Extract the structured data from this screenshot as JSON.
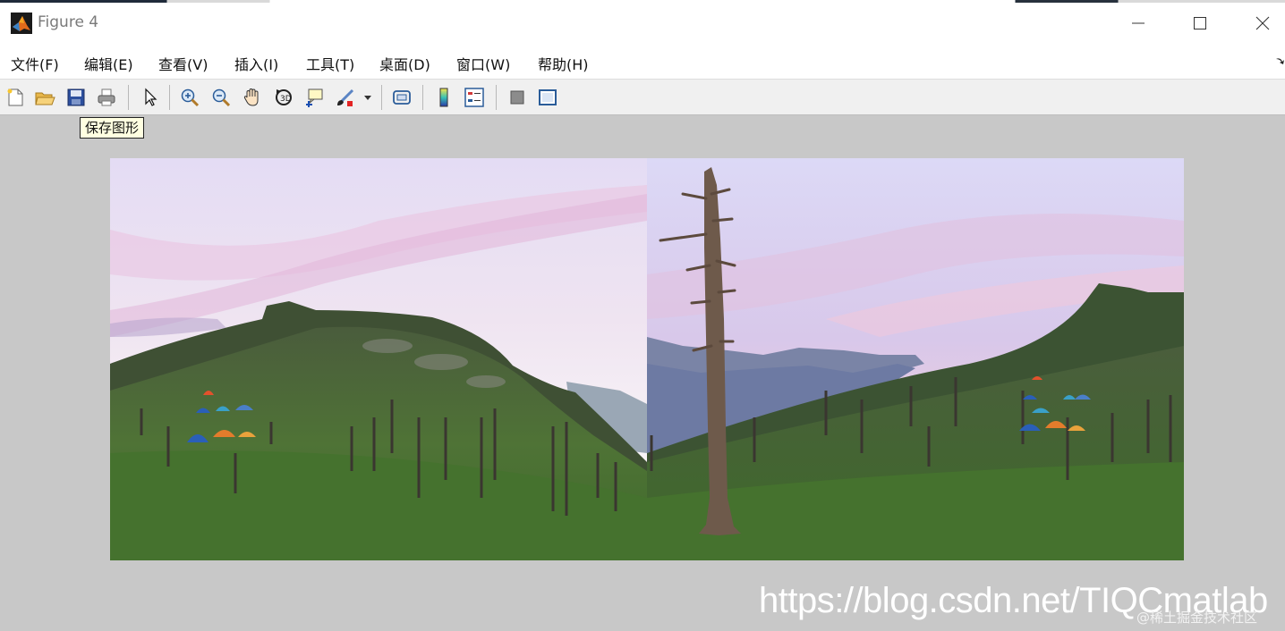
{
  "window": {
    "title": "Figure 4",
    "controls": [
      "minimize",
      "maximize",
      "close"
    ]
  },
  "menu": {
    "items": [
      {
        "label": "文件(F)"
      },
      {
        "label": "编辑(E)"
      },
      {
        "label": "查看(V)"
      },
      {
        "label": "插入(I)"
      },
      {
        "label": "工具(T)"
      },
      {
        "label": "桌面(D)"
      },
      {
        "label": "窗口(W)"
      },
      {
        "label": "帮助(H)"
      }
    ]
  },
  "toolbar": {
    "buttons": [
      "new-figure-icon",
      "open-file-icon",
      "save-figure-icon",
      "print-figure-icon",
      "edit-plot-cursor-icon",
      "zoom-in-icon",
      "zoom-out-icon",
      "pan-hand-icon",
      "rotate-3d-icon",
      "data-cursor-icon",
      "brush-icon",
      "brush-dropdown-icon",
      "link-plot-icon",
      "insert-colorbar-icon",
      "insert-legend-icon",
      "hide-plot-tools-icon",
      "show-plot-tools-icon"
    ],
    "tooltip": "保存图形"
  },
  "figure": {
    "images": [
      {
        "description": "left-panorama"
      },
      {
        "description": "right-panorama"
      }
    ]
  },
  "watermark": {
    "url": "https://blog.csdn.net/TIQCmatlab",
    "community": "@稀土掘金技术社区"
  }
}
